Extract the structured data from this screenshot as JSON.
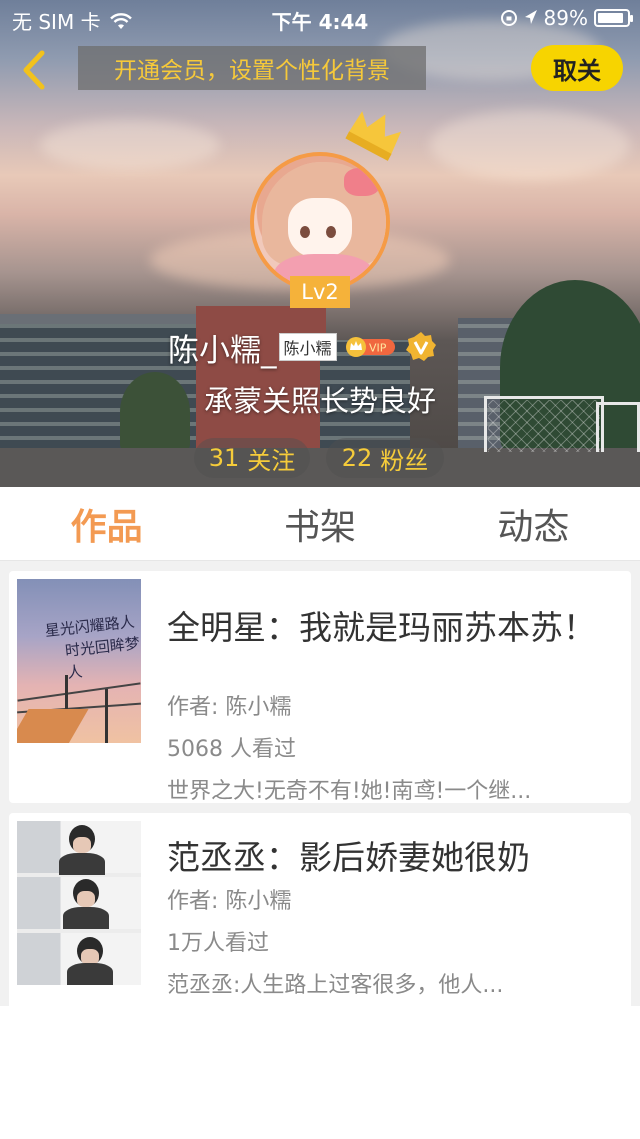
{
  "status_bar": {
    "carrier": "无 SIM 卡",
    "time": "下午 4:44",
    "battery": "89%",
    "battery_level": 0.89
  },
  "top_nav": {
    "vip_banner": "开通会员，设置个性化背景",
    "unfollow_label": "取关"
  },
  "profile": {
    "level": "Lv2",
    "username": "陈小糯_",
    "name_tag": "陈小糯",
    "vip_badge": "VIP",
    "signature": "承蒙关照长势良好",
    "following_count": "31",
    "following_label": "关注",
    "followers_count": "22",
    "followers_label": "粉丝"
  },
  "tabs": [
    {
      "label": "作品",
      "active": true
    },
    {
      "label": "书架",
      "active": false
    },
    {
      "label": "动态",
      "active": false
    }
  ],
  "works": [
    {
      "title": "全明星：我就是玛丽苏本苏！",
      "author": "作者: 陈小糯",
      "views": "5068 人看过",
      "description": "世界之大!无奇不有!她!南鸢!一个继...",
      "cover_text": [
        "星光闪耀路人",
        "时光回眸梦人"
      ]
    },
    {
      "title": "范丞丞：影后娇妻她很奶",
      "author": "作者: 陈小糯",
      "views": "1万人看过",
      "description": "范丞丞:人生路上过客很多，他人..."
    }
  ],
  "colors": {
    "accent_orange": "#f39a52",
    "accent_yellow": "#f7d400",
    "banner_text": "#f6c93a"
  }
}
